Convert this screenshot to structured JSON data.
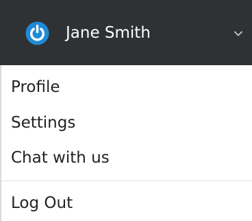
{
  "user_menu": {
    "user_name": "Jane Smith",
    "avatar_icon": "power-icon",
    "avatar_color": "#1f8ad6",
    "header_background": "#2e3234",
    "toggle_icon": "chevron-down-icon"
  },
  "menu": {
    "items": [
      {
        "label": "Profile"
      },
      {
        "label": "Settings"
      },
      {
        "label": "Chat with us"
      }
    ],
    "logout_label": "Log Out"
  }
}
